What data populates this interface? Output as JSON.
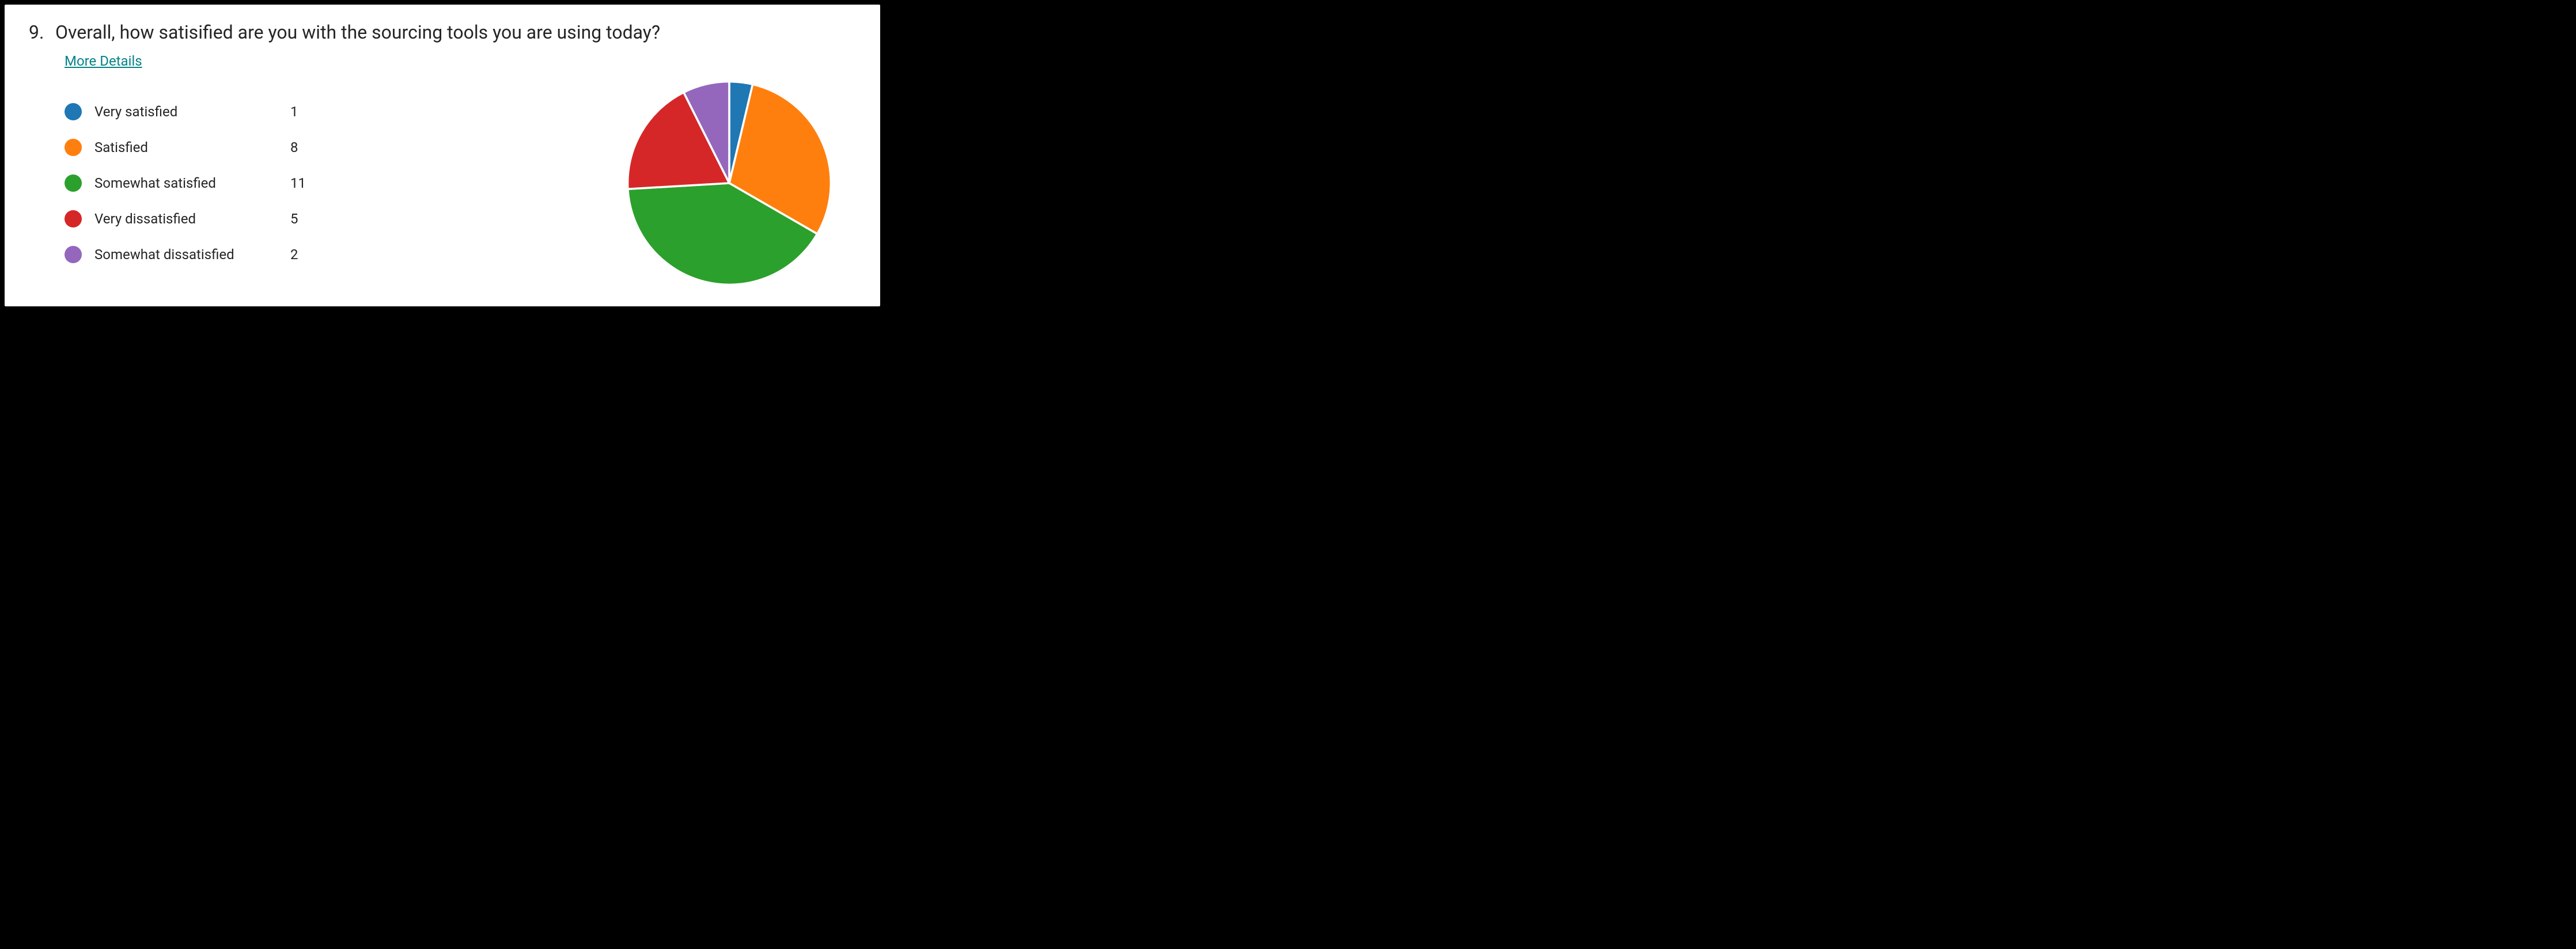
{
  "question": {
    "number": "9.",
    "text": "Overall, how satisified are you with the sourcing tools you are using today?",
    "more_details_label": "More Details"
  },
  "legend": {
    "items": [
      {
        "label": "Very satisfied",
        "value": 1,
        "color": "#1f77b4"
      },
      {
        "label": "Satisfied",
        "value": 8,
        "color": "#ff7f0e"
      },
      {
        "label": "Somewhat satisfied",
        "value": 11,
        "color": "#2ca02c"
      },
      {
        "label": "Very dissatisfied",
        "value": 5,
        "color": "#d62728"
      },
      {
        "label": "Somewhat dissatisfied",
        "value": 2,
        "color": "#9467bd"
      }
    ]
  },
  "chart_data": {
    "type": "pie",
    "title": "",
    "categories": [
      "Very satisfied",
      "Satisfied",
      "Somewhat satisfied",
      "Very dissatisfied",
      "Somewhat dissatisfied"
    ],
    "values": [
      1,
      8,
      11,
      5,
      2
    ],
    "colors": [
      "#1f77b4",
      "#ff7f0e",
      "#2ca02c",
      "#d62728",
      "#9467bd"
    ],
    "legend_position": "left"
  }
}
